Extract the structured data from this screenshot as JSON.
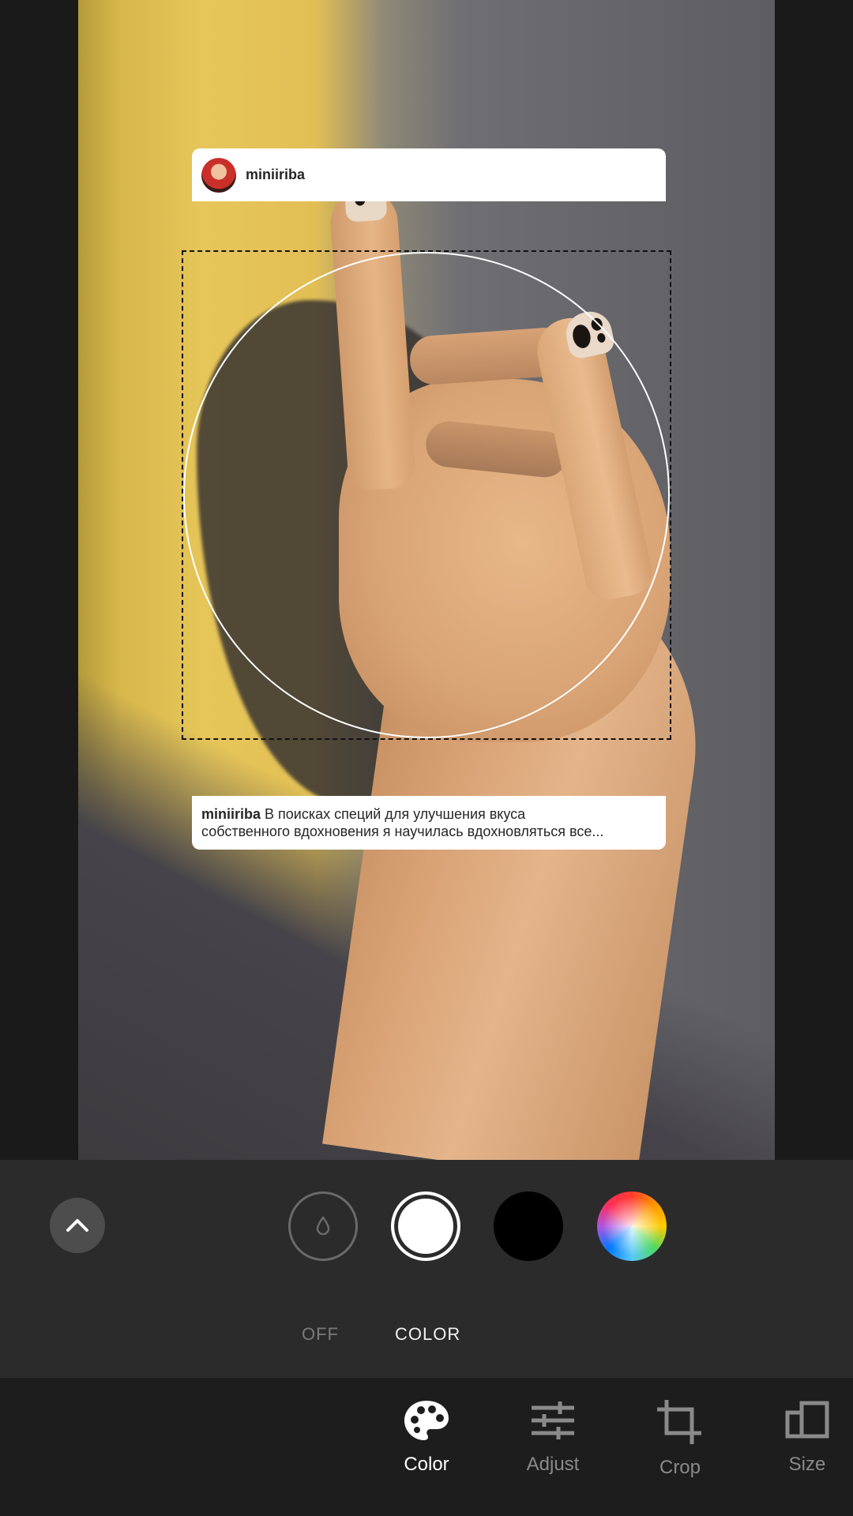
{
  "post": {
    "username": "miniiriba",
    "caption_user": "miniiriba",
    "caption_line1": "В поисках специй для улучшения вкуса",
    "caption_line2": "собственного вдохновения я научилась вдохновляться все..."
  },
  "color_panel": {
    "modes": {
      "off": "OFF",
      "color": "COLOR"
    },
    "selected_mode": "COLOR",
    "swatches": [
      "off",
      "white",
      "black",
      "color-wheel"
    ],
    "selected_swatch": "white"
  },
  "toolbar": {
    "items": [
      {
        "label": "Color",
        "icon": "palette-icon",
        "active": true
      },
      {
        "label": "Adjust",
        "icon": "sliders-icon",
        "active": false
      },
      {
        "label": "Crop",
        "icon": "crop-icon",
        "active": false
      },
      {
        "label": "Size",
        "icon": "size-icon",
        "active": false
      }
    ]
  },
  "colors": {
    "panel_bg": "#2b2b2b",
    "toolbar_bg": "#1d1d1d",
    "active_label": "#ffffff",
    "inactive_label": "#8a8a8a"
  }
}
